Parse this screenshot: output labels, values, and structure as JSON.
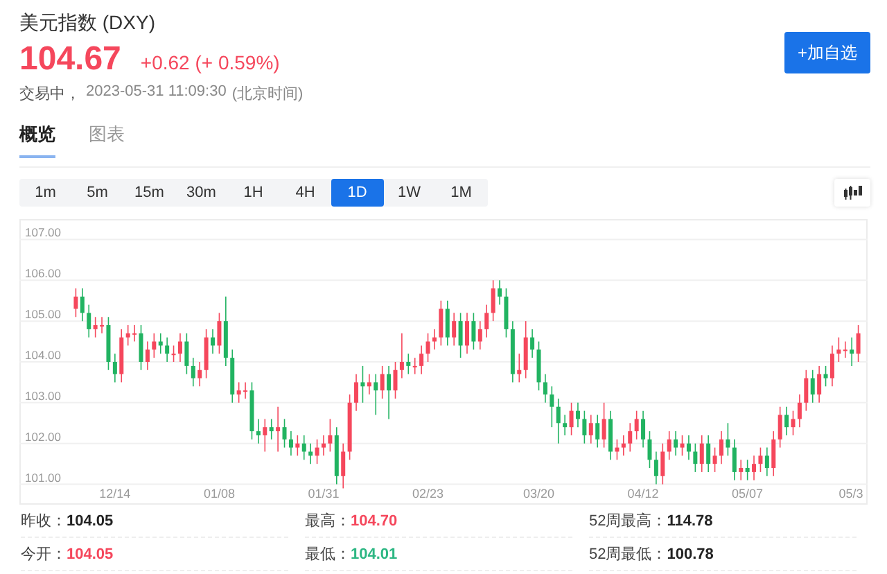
{
  "header": {
    "title": "美元指数 (DXY)",
    "price": "104.67",
    "change": "+0.62",
    "change_percent": "(+ 0.59%)",
    "status": "交易中，",
    "timestamp": "2023-05-31 11:09:30",
    "timezone": "(北京时间)",
    "watchlist_button": "+加自选"
  },
  "tabs": [
    {
      "label": "概览",
      "selected": true
    },
    {
      "label": "图表",
      "selected": false
    }
  ],
  "periods": [
    {
      "label": "1m",
      "selected": false
    },
    {
      "label": "5m",
      "selected": false
    },
    {
      "label": "15m",
      "selected": false
    },
    {
      "label": "30m",
      "selected": false
    },
    {
      "label": "1H",
      "selected": false
    },
    {
      "label": "4H",
      "selected": false
    },
    {
      "label": "1D",
      "selected": true
    },
    {
      "label": "1W",
      "selected": false
    },
    {
      "label": "1M",
      "selected": false
    }
  ],
  "chart": {
    "chart_data": {
      "type": "candlestick",
      "grid": true,
      "ylim": [
        100.5,
        107.5
      ],
      "yticks": [
        {
          "value": 101,
          "label": "101.00"
        },
        {
          "value": 102,
          "label": "102.00"
        },
        {
          "value": 103,
          "label": "103.00"
        },
        {
          "value": 104,
          "label": "104.00"
        },
        {
          "value": 105,
          "label": "105.00"
        },
        {
          "value": 106,
          "label": "106.00"
        },
        {
          "value": 107,
          "label": "107.00"
        }
      ],
      "categories": [
        null,
        null,
        null,
        null,
        null,
        null,
        "12/14",
        null,
        null,
        null,
        null,
        null,
        null,
        null,
        null,
        null,
        null,
        null,
        null,
        null,
        null,
        null,
        "01/08",
        null,
        null,
        null,
        null,
        null,
        null,
        null,
        null,
        null,
        null,
        null,
        null,
        null,
        null,
        null,
        "01/31",
        null,
        null,
        null,
        null,
        null,
        null,
        null,
        null,
        null,
        null,
        null,
        null,
        null,
        null,
        null,
        "02/23",
        null,
        null,
        null,
        null,
        null,
        null,
        null,
        null,
        null,
        null,
        null,
        null,
        null,
        null,
        null,
        null,
        "03/20",
        null,
        null,
        null,
        null,
        null,
        null,
        null,
        null,
        null,
        null,
        null,
        null,
        null,
        null,
        null,
        "04/12",
        null,
        null,
        null,
        null,
        null,
        null,
        null,
        null,
        null,
        null,
        null,
        null,
        null,
        null,
        null,
        "05/07",
        null,
        null,
        null,
        null,
        null,
        null,
        null,
        null,
        null,
        null,
        null,
        null,
        null,
        null,
        null,
        "05/3",
        null
      ],
      "ohlc": [
        [
          105.3,
          105.8,
          105.1,
          105.6
        ],
        [
          105.6,
          105.8,
          105.0,
          105.2
        ],
        [
          105.2,
          105.4,
          104.6,
          104.8
        ],
        [
          104.8,
          105.1,
          104.6,
          104.9
        ],
        [
          104.9,
          105.1,
          104.7,
          104.9
        ],
        [
          104.9,
          105.1,
          103.8,
          104.0
        ],
        [
          104.0,
          104.2,
          103.5,
          103.7
        ],
        [
          103.7,
          104.8,
          103.5,
          104.6
        ],
        [
          104.6,
          104.9,
          104.4,
          104.7
        ],
        [
          104.7,
          104.9,
          104.5,
          104.7
        ],
        [
          104.7,
          104.9,
          103.8,
          104.0
        ],
        [
          104.0,
          104.5,
          103.8,
          104.3
        ],
        [
          104.3,
          104.7,
          104.1,
          104.5
        ],
        [
          104.5,
          104.7,
          104.2,
          104.4
        ],
        [
          104.4,
          104.6,
          104.0,
          104.2
        ],
        [
          104.2,
          104.4,
          104.0,
          104.2
        ],
        [
          104.2,
          104.7,
          104.0,
          104.5
        ],
        [
          104.5,
          104.7,
          103.7,
          103.9
        ],
        [
          103.9,
          104.1,
          103.4,
          103.6
        ],
        [
          103.6,
          104.0,
          103.4,
          103.8
        ],
        [
          103.8,
          104.8,
          103.6,
          104.6
        ],
        [
          104.6,
          104.8,
          104.2,
          104.4
        ],
        [
          104.4,
          105.2,
          104.2,
          105.0
        ],
        [
          105.0,
          105.6,
          103.9,
          104.1
        ],
        [
          104.1,
          104.3,
          103.0,
          103.2
        ],
        [
          103.2,
          103.5,
          103.0,
          103.3
        ],
        [
          103.3,
          103.5,
          103.1,
          103.3
        ],
        [
          103.3,
          103.5,
          102.1,
          102.3
        ],
        [
          102.3,
          102.6,
          102.0,
          102.2
        ],
        [
          102.2,
          102.6,
          101.8,
          102.4
        ],
        [
          102.4,
          102.6,
          102.1,
          102.3
        ],
        [
          102.3,
          102.9,
          101.8,
          102.4
        ],
        [
          102.4,
          102.6,
          101.9,
          102.1
        ],
        [
          102.1,
          102.3,
          101.7,
          101.9
        ],
        [
          101.9,
          102.2,
          101.7,
          102.0
        ],
        [
          102.0,
          102.2,
          101.6,
          101.8
        ],
        [
          101.8,
          102.0,
          101.5,
          101.7
        ],
        [
          101.7,
          102.1,
          101.5,
          101.9
        ],
        [
          101.9,
          102.2,
          101.7,
          102.0
        ],
        [
          102.0,
          102.6,
          101.8,
          102.2
        ],
        [
          102.2,
          102.4,
          101.0,
          101.2
        ],
        [
          101.2,
          102.0,
          100.9,
          101.8
        ],
        [
          101.8,
          103.2,
          101.6,
          103.0
        ],
        [
          103.0,
          103.7,
          102.8,
          103.5
        ],
        [
          103.5,
          103.9,
          103.0,
          103.4
        ],
        [
          103.4,
          103.7,
          103.2,
          103.5
        ],
        [
          103.5,
          103.7,
          102.7,
          103.3
        ],
        [
          103.3,
          103.9,
          103.1,
          103.7
        ],
        [
          103.7,
          103.9,
          102.6,
          103.3
        ],
        [
          103.3,
          104.0,
          103.1,
          103.8
        ],
        [
          103.8,
          104.7,
          103.6,
          104.0
        ],
        [
          104.0,
          104.2,
          103.7,
          103.9
        ],
        [
          103.9,
          104.1,
          103.7,
          103.9
        ],
        [
          103.9,
          104.4,
          103.7,
          104.2
        ],
        [
          104.2,
          104.7,
          104.0,
          104.5
        ],
        [
          104.5,
          104.8,
          104.3,
          104.6
        ],
        [
          104.6,
          105.5,
          104.4,
          105.3
        ],
        [
          105.3,
          105.5,
          104.4,
          104.6
        ],
        [
          104.6,
          105.2,
          104.4,
          105.0
        ],
        [
          105.0,
          105.2,
          104.1,
          104.4
        ],
        [
          104.4,
          105.2,
          104.2,
          105.0
        ],
        [
          105.0,
          105.2,
          104.3,
          104.5
        ],
        [
          104.5,
          105.0,
          104.3,
          104.8
        ],
        [
          104.8,
          105.4,
          104.6,
          105.2
        ],
        [
          105.2,
          106.0,
          105.0,
          105.8
        ],
        [
          105.8,
          106.0,
          105.4,
          105.6
        ],
        [
          105.6,
          105.8,
          104.6,
          104.8
        ],
        [
          104.8,
          105.0,
          103.5,
          103.7
        ],
        [
          103.7,
          104.2,
          103.5,
          103.8
        ],
        [
          103.8,
          105.0,
          103.6,
          104.6
        ],
        [
          104.6,
          104.8,
          104.1,
          104.3
        ],
        [
          104.3,
          104.5,
          103.3,
          103.5
        ],
        [
          103.5,
          103.7,
          103.0,
          103.2
        ],
        [
          103.2,
          103.4,
          102.4,
          102.9
        ],
        [
          102.9,
          103.1,
          102.0,
          102.5
        ],
        [
          102.5,
          102.7,
          102.2,
          102.4
        ],
        [
          102.4,
          103.0,
          102.2,
          102.8
        ],
        [
          102.8,
          103.0,
          102.4,
          102.6
        ],
        [
          102.6,
          102.8,
          102.0,
          102.2
        ],
        [
          102.2,
          102.7,
          102.0,
          102.5
        ],
        [
          102.5,
          102.7,
          101.9,
          102.1
        ],
        [
          102.1,
          103.0,
          101.9,
          102.6
        ],
        [
          102.6,
          102.8,
          101.6,
          101.8
        ],
        [
          101.8,
          102.1,
          101.6,
          101.9
        ],
        [
          101.9,
          102.2,
          101.7,
          102.0
        ],
        [
          102.0,
          102.5,
          101.8,
          102.3
        ],
        [
          102.3,
          102.8,
          102.1,
          102.6
        ],
        [
          102.6,
          102.8,
          101.9,
          102.1
        ],
        [
          102.1,
          102.3,
          101.4,
          101.6
        ],
        [
          101.6,
          101.8,
          101.0,
          101.2
        ],
        [
          101.2,
          102.0,
          101.0,
          101.8
        ],
        [
          101.8,
          102.3,
          101.6,
          102.1
        ],
        [
          102.1,
          102.3,
          101.7,
          101.9
        ],
        [
          101.9,
          102.2,
          101.7,
          102.0
        ],
        [
          102.0,
          102.2,
          101.6,
          101.8
        ],
        [
          101.8,
          102.0,
          101.3,
          101.5
        ],
        [
          101.5,
          102.2,
          101.3,
          102.0
        ],
        [
          102.0,
          102.2,
          101.3,
          101.5
        ],
        [
          101.5,
          101.9,
          101.3,
          101.7
        ],
        [
          101.7,
          102.3,
          101.5,
          102.1
        ],
        [
          102.1,
          102.5,
          101.7,
          101.9
        ],
        [
          101.9,
          102.1,
          101.1,
          101.3
        ],
        [
          101.3,
          101.6,
          101.1,
          101.4
        ],
        [
          101.4,
          101.6,
          101.1,
          101.3
        ],
        [
          101.3,
          101.7,
          101.1,
          101.5
        ],
        [
          101.5,
          101.9,
          101.3,
          101.7
        ],
        [
          101.7,
          101.9,
          101.2,
          101.4
        ],
        [
          101.4,
          102.3,
          101.2,
          102.1
        ],
        [
          102.1,
          102.9,
          101.9,
          102.7
        ],
        [
          102.7,
          102.9,
          102.2,
          102.4
        ],
        [
          102.4,
          102.8,
          102.2,
          102.6
        ],
        [
          102.6,
          103.2,
          102.4,
          103.0
        ],
        [
          103.0,
          103.8,
          102.8,
          103.6
        ],
        [
          103.6,
          103.8,
          103.0,
          103.2
        ],
        [
          103.2,
          103.9,
          103.0,
          103.7
        ],
        [
          103.7,
          103.9,
          103.4,
          103.6
        ],
        [
          103.6,
          104.4,
          103.4,
          104.2
        ],
        [
          104.2,
          104.6,
          104.0,
          104.3
        ],
        [
          104.3,
          104.5,
          104.1,
          104.3
        ],
        [
          104.3,
          104.6,
          103.9,
          104.2
        ],
        [
          104.2,
          104.9,
          104.0,
          104.7
        ]
      ]
    }
  },
  "stats": [
    {
      "label": "昨收：",
      "value": "104.05",
      "color": "#222222"
    },
    {
      "label": "最高：",
      "value": "104.70",
      "color": "#f5475c"
    },
    {
      "label": "52周最高：",
      "value": "114.78",
      "color": "#222222"
    },
    {
      "label": "今开：",
      "value": "104.05",
      "color": "#f5475c"
    },
    {
      "label": "最低：",
      "value": "104.01",
      "color": "#2db783"
    },
    {
      "label": "52周最低：",
      "value": "100.78",
      "color": "#222222"
    }
  ]
}
